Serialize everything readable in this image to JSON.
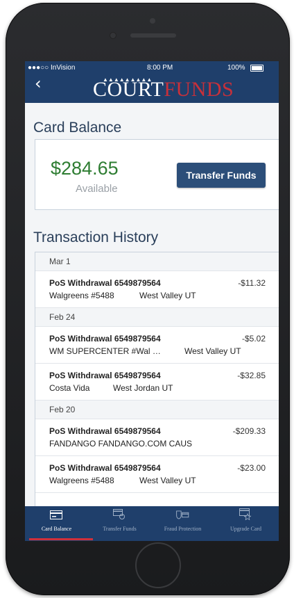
{
  "status_bar": {
    "carrier": "●●●○○ InVision",
    "time": "8:00 PM",
    "battery": "100%"
  },
  "header": {
    "back_glyph": "‹",
    "logo_part1": "COURT",
    "logo_part2": "FUNDS",
    "logo_marks": "▲▲▲▲▲▲▲▲▲"
  },
  "balance": {
    "section_title": "Card Balance",
    "amount": "$284.65",
    "available_label": "Available",
    "transfer_button": "Transfer Funds"
  },
  "history": {
    "section_title": "Transaction History",
    "groups": [
      {
        "date": "Mar 1",
        "items": [
          {
            "desc": "PoS Withdrawal 6549879564",
            "amount": "-$11.32",
            "merchant": "Walgreens #5488",
            "location": "West Valley UT"
          }
        ]
      },
      {
        "date": "Feb 24",
        "items": [
          {
            "desc": "PoS Withdrawal 6549879564",
            "amount": "-$5.02",
            "merchant": "WM SUPERCENTER #Wal …",
            "location": "West Valley UT"
          },
          {
            "desc": "PoS Withdrawal 6549879564",
            "amount": "-$32.85",
            "merchant": "Costa Vida",
            "location": "West Jordan UT"
          }
        ]
      },
      {
        "date": "Feb 20",
        "items": [
          {
            "desc": "PoS Withdrawal 6549879564",
            "amount": "-$209.33",
            "merchant": "FANDANGO FANDANGO.COM CAUS",
            "location": ""
          },
          {
            "desc": "PoS Withdrawal 6549879564",
            "amount": "-$23.00",
            "merchant": "Walgreens #5488",
            "location": "West Valley UT"
          }
        ]
      }
    ]
  },
  "tabbar": {
    "tabs": [
      {
        "label": "Card Balance",
        "icon": "card-icon",
        "active": true
      },
      {
        "label": "Transfer Funds",
        "icon": "transfer-card-icon",
        "active": false
      },
      {
        "label": "Fraud Protection",
        "icon": "shield-card-icon",
        "active": false
      },
      {
        "label": "Upgrade Card",
        "icon": "star-card-icon",
        "active": false
      }
    ]
  },
  "colors": {
    "brand_navy": "#1f3f6b",
    "accent_red": "#c8303a",
    "balance_green": "#2e7d32",
    "button_blue": "#2c4e79"
  }
}
